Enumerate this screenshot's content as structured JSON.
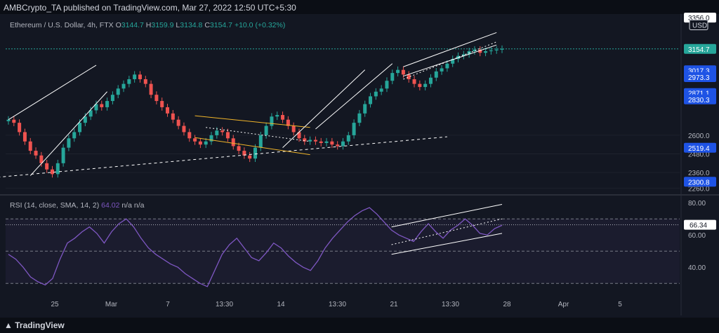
{
  "header": {
    "publisher": "AMBCrypto_TA published on TradingView.com, Mar 27, 2022 12:50 UTC+5:30"
  },
  "legend": {
    "symbol": "Ethereum / U.S. Dollar, 4h, FTX",
    "open_label": "O",
    "open": "3144.7",
    "high_label": "H",
    "high": "3159.9",
    "low_label": "L",
    "low": "3134.8",
    "close_label": "C",
    "close": "3154.7",
    "change": "+10.0 (+0.32%)"
  },
  "rsi_legend": {
    "label": "RSI (14, close, SMA, 14, 2)",
    "value": "64.02",
    "na1": "n/a",
    "na2": "n/a"
  },
  "footer": {
    "logo": "TradingView"
  },
  "colors": {
    "up": "#26a69a",
    "down": "#ef5350",
    "rsi": "#7e57c2",
    "level_label": "#1e53e5",
    "channel_yellow": "#f0b429"
  },
  "chart_data": [
    {
      "type": "candlestick",
      "title": "Ethereum / U.S. Dollar, 4h, FTX",
      "currency": "USD",
      "y_ticks": [
        2260.0,
        2360.0,
        2480.0,
        2600.0
      ],
      "ylim": [
        2230,
        3370
      ],
      "price_labels": [
        "3356.0",
        "3154.7",
        "3017.3",
        "2973.3",
        "2871.1",
        "2830.3",
        "2519.4",
        "2300.8"
      ],
      "last_price": "3154.7",
      "x_tick_labels": [
        "25",
        "Mar",
        "7",
        "13:30",
        "14",
        "13:30",
        "21",
        "13:30",
        "28",
        "Apr",
        "5"
      ],
      "close_series": [
        2700,
        2680,
        2620,
        2560,
        2500,
        2470,
        2420,
        2380,
        2350,
        2420,
        2520,
        2580,
        2620,
        2680,
        2720,
        2760,
        2800,
        2780,
        2820,
        2860,
        2900,
        2930,
        2960,
        2990,
        2960,
        2930,
        2860,
        2820,
        2780,
        2740,
        2700,
        2660,
        2620,
        2580,
        2560,
        2540,
        2560,
        2600,
        2630,
        2620,
        2580,
        2530,
        2500,
        2470,
        2450,
        2520,
        2600,
        2660,
        2720,
        2730,
        2700,
        2660,
        2620,
        2580,
        2560,
        2570,
        2560,
        2550,
        2560,
        2540,
        2530,
        2560,
        2600,
        2680,
        2740,
        2800,
        2850,
        2880,
        2900,
        2950,
        3000,
        3020,
        2990,
        2960,
        2930,
        2910,
        2930,
        2970,
        3010,
        3030,
        3060,
        3090,
        3110,
        3120,
        3140,
        3150,
        3130,
        3140,
        3145,
        3150,
        3155
      ]
    },
    {
      "type": "line",
      "title": "RSI (14, close, SMA, 14, 2)",
      "y_ticks": [
        40.0,
        60.0,
        80.0
      ],
      "ylim": [
        24,
        84
      ],
      "levels": [
        70,
        50,
        30
      ],
      "value_label": "66.34",
      "rsi_series": [
        48,
        45,
        40,
        34,
        31,
        29,
        33,
        45,
        55,
        58,
        62,
        65,
        61,
        55,
        62,
        67,
        70,
        65,
        58,
        52,
        48,
        45,
        42,
        40,
        36,
        33,
        30,
        28,
        38,
        48,
        54,
        58,
        52,
        46,
        44,
        49,
        55,
        52,
        47,
        43,
        40,
        38,
        44,
        52,
        58,
        63,
        68,
        72,
        75,
        77,
        73,
        68,
        63,
        60,
        58,
        56,
        62,
        67,
        62,
        58,
        63,
        66,
        70,
        66,
        61,
        60,
        64,
        66
      ]
    }
  ]
}
